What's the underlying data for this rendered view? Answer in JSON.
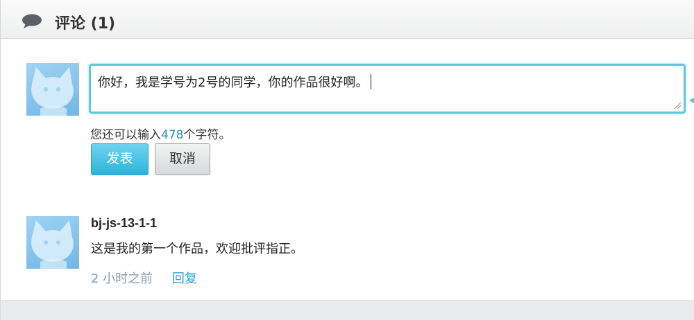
{
  "header": {
    "title": "评论 (1)",
    "icon": "speech-bubble-icon"
  },
  "composer": {
    "text": "你好，我是学号为2号的同学，你的作品很好啊。",
    "remaining_prefix": "您还可以输入",
    "remaining_count": "478",
    "remaining_suffix": "个字符。",
    "publish_label": "发表",
    "cancel_label": "取消"
  },
  "comments": [
    {
      "author": "bj-js-13-1-1",
      "text": "这是我的第一个作品，欢迎批评指正。",
      "time": "2 小时之前",
      "reply_label": "回复"
    }
  ],
  "colors": {
    "accent": "#5cc8d8",
    "publish_button": "#2db3dc",
    "link": "#2aa0d8",
    "muted_time": "#8a9ca8"
  }
}
